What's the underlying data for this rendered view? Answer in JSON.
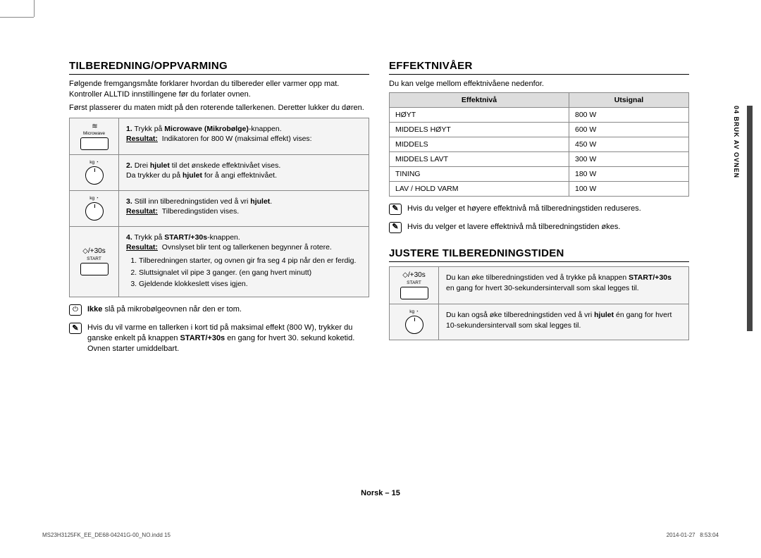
{
  "sideTab": "04  BRUK AV OVNEN",
  "footer": {
    "center": "Norsk – 15",
    "left": "MS23H3125FK_EE_DE68-04241G-00_NO.indd   15",
    "rightDate": "2014-01-27",
    "rightTime": "8:53:04"
  },
  "iconLabels": {
    "microwave": "Microwave",
    "start30s": "+30s",
    "startLabel": "START",
    "dialTop": "kg  ◔"
  },
  "leftCol": {
    "heading": "TILBEREDNING/OPPVARMING",
    "p1": "Følgende fremgangsmåte forklarer hvordan du tilbereder eller varmer opp mat. Kontroller ALLTID innstillingene før du forlater ovnen.",
    "p2": "Først plasserer du maten midt på den roterende tallerkenen. Deretter lukker du døren.",
    "steps": [
      {
        "num": "1.",
        "pre": "Trykk på ",
        "bold1": "Microwave (Mikrobølge)",
        "post1": "-knappen.",
        "resLabel": "Resultat:",
        "resText": "Indikatoren for 800 W (maksimal effekt) vises:"
      },
      {
        "num": "2.",
        "l1a": "Drei ",
        "l1b": "hjulet",
        "l1c": " til det ønskede effektnivået vises.",
        "l2a": "Da trykker du på ",
        "l2b": "hjulet",
        "l2c": " for å angi effektnivået."
      },
      {
        "num": "3.",
        "l1a": "Still inn tilberedningstiden ved å vri ",
        "l1b": "hjulet",
        "l1c": ".",
        "resLabel": "Resultat:",
        "resText": "Tilberedingstiden vises."
      },
      {
        "num": "4.",
        "l1a": "Trykk på ",
        "l1b": "START/+30s",
        "l1c": "-knappen.",
        "resLabel": "Resultat:",
        "resText": "Ovnslyset blir tent og tallerkenen begynner å rotere.",
        "sub": [
          "Tilberedningen starter, og ovnen gir fra seg 4 pip når den er ferdig.",
          "Sluttsignalet vil pipe 3 ganger. (en gang hvert minutt)",
          "Gjeldende klokkeslett vises igjen."
        ]
      }
    ],
    "warn1a": "Ikke",
    "warn1b": " slå på mikrobølgeovnen når den er tom.",
    "note2a": "Hvis du vil varme en tallerken i kort tid på maksimal effekt (800 W), trykker du ganske enkelt på knappen ",
    "note2b": "START/+30s",
    "note2c": " en gang for hvert 30. sekund koketid. Ovnen starter umiddelbart."
  },
  "rightCol": {
    "heading1": "EFFEKTNIVÅER",
    "p1": "Du kan velge mellom effektnivåene nedenfor.",
    "table": {
      "h1": "Effektnivå",
      "h2": "Utsignal",
      "rows": [
        [
          "HØYT",
          "800 W"
        ],
        [
          "MIDDELS HØYT",
          "600 W"
        ],
        [
          "MIDDELS",
          "450 W"
        ],
        [
          "MIDDELS LAVT",
          "300 W"
        ],
        [
          "TINING",
          "180 W"
        ],
        [
          "LAV / HOLD VARM",
          "100 W"
        ]
      ]
    },
    "noteA": "Hvis du velger et høyere effektnivå må tilberedningstiden reduseres.",
    "noteB": "Hvis du velger et lavere effektnivå må tilberedningstiden økes.",
    "heading2": "JUSTERE TILBEREDNINGSTIDEN",
    "adjust": [
      {
        "a": "Du kan øke tilberedningstiden ved å trykke på knappen ",
        "b": "START/+30s",
        "c": " en gang for hvert 30-sekundersintervall som skal legges til."
      },
      {
        "a": "Du kan også øke tilberedningstiden ved å vri ",
        "b": "hjulet",
        "c": " én gang for hvert 10-sekundersintervall som skal legges til."
      }
    ]
  },
  "chart_data": {
    "type": "table",
    "title": "Effektnivåer",
    "columns": [
      "Effektnivå",
      "Utsignal"
    ],
    "rows": [
      {
        "level": "HØYT",
        "watts": 800
      },
      {
        "level": "MIDDELS HØYT",
        "watts": 600
      },
      {
        "level": "MIDDELS",
        "watts": 450
      },
      {
        "level": "MIDDELS LAVT",
        "watts": 300
      },
      {
        "level": "TINING",
        "watts": 180
      },
      {
        "level": "LAV / HOLD VARM",
        "watts": 100
      }
    ]
  }
}
